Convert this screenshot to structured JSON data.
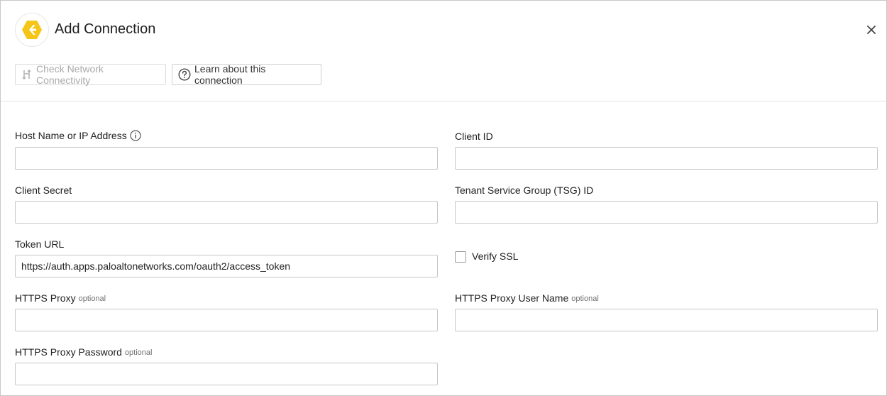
{
  "dialog": {
    "title": "Add Connection",
    "logo_icon": "hexagon-chevron-logo",
    "brand_color": "#F5C518",
    "close_icon": "close-icon"
  },
  "toolbar": {
    "check_network_label": "Check Network Connectivity",
    "check_network_disabled": true,
    "learn_label": "Learn about this connection"
  },
  "form": {
    "host": {
      "label": "Host Name or IP Address",
      "value": "",
      "has_info_icon": true
    },
    "client_id": {
      "label": "Client ID",
      "value": ""
    },
    "client_secret": {
      "label": "Client Secret",
      "value": ""
    },
    "tsg_id": {
      "label": "Tenant Service Group (TSG) ID",
      "value": ""
    },
    "token_url": {
      "label": "Token URL",
      "value": "https://auth.apps.paloaltonetworks.com/oauth2/access_token"
    },
    "verify_ssl": {
      "label": "Verify SSL",
      "checked": false
    },
    "https_proxy": {
      "label": "HTTPS Proxy",
      "optional": "optional",
      "value": ""
    },
    "https_proxy_user": {
      "label": "HTTPS Proxy User Name",
      "optional": "optional",
      "value": ""
    },
    "https_proxy_password": {
      "label": "HTTPS Proxy Password",
      "optional": "optional",
      "value": ""
    }
  }
}
